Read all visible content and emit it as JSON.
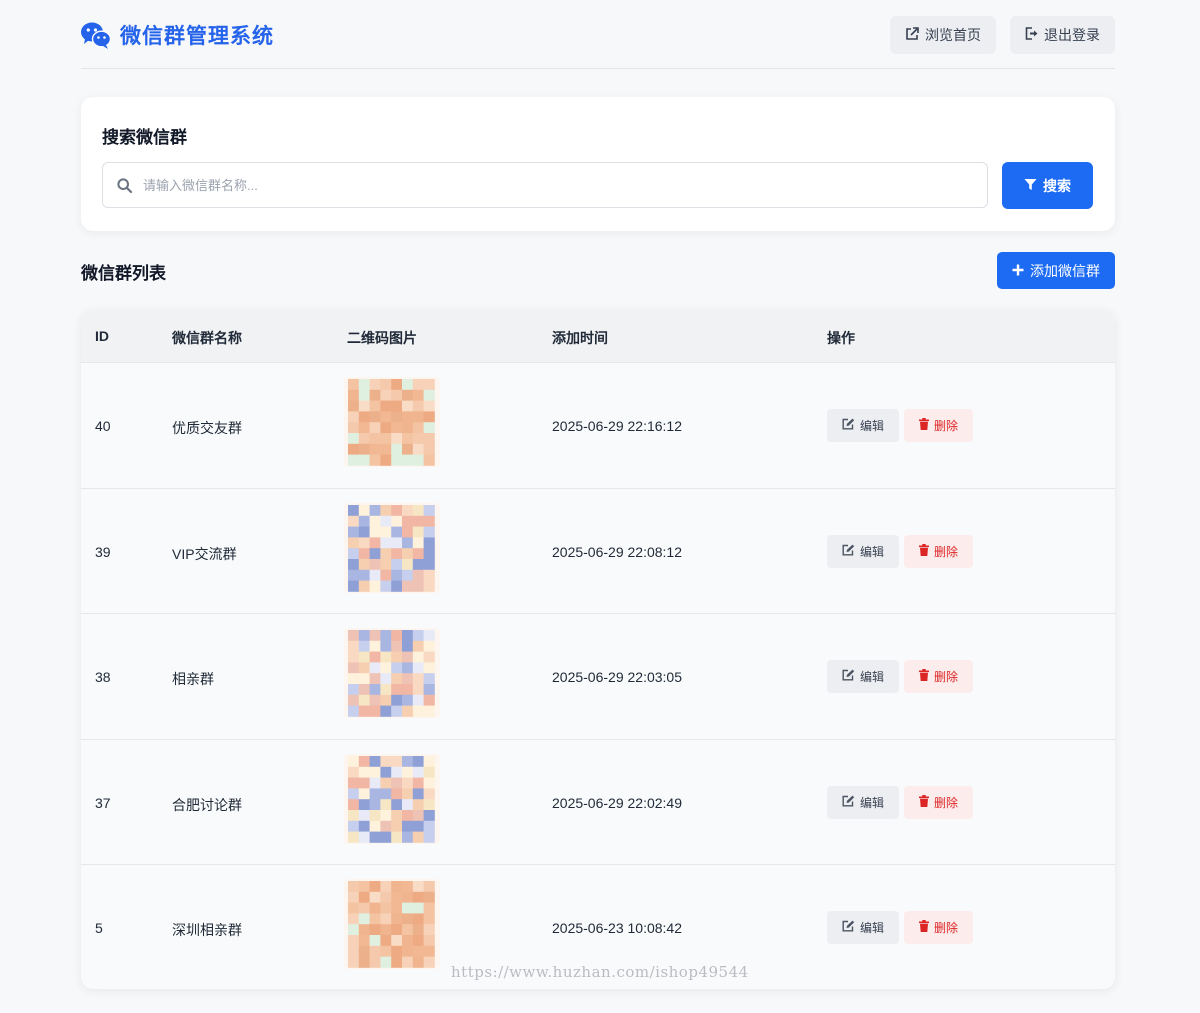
{
  "header": {
    "title": "微信群管理系统",
    "home_label": "浏览首页",
    "logout_label": "退出登录"
  },
  "search": {
    "title": "搜索微信群",
    "placeholder": "请输入微信群名称...",
    "value": "",
    "button_label": "搜索"
  },
  "list": {
    "title": "微信群列表",
    "add_label": "添加微信群",
    "columns": [
      "ID",
      "微信群名称",
      "二维码图片",
      "添加时间",
      "操作"
    ],
    "rows": [
      {
        "id": "40",
        "name": "优质交友群",
        "time": "2025-06-29 22:16:12",
        "edit": "编辑",
        "delete": "删除"
      },
      {
        "id": "39",
        "name": "VIP交流群",
        "time": "2025-06-29 22:08:12",
        "edit": "编辑",
        "delete": "删除"
      },
      {
        "id": "38",
        "name": "相亲群",
        "time": "2025-06-29 22:03:05",
        "edit": "编辑",
        "delete": "删除"
      },
      {
        "id": "37",
        "name": "合肥讨论群",
        "time": "2025-06-29 22:02:49",
        "edit": "编辑",
        "delete": "删除"
      },
      {
        "id": "5",
        "name": "深圳相亲群",
        "time": "2025-06-23 10:08:42",
        "edit": "编辑",
        "delete": "删除"
      }
    ]
  },
  "watermark": "https://www.huzhan.com/ishop49544",
  "colors": {
    "primary": "#1d6bf3",
    "brand_text": "#2563eb",
    "danger": "#dc2626",
    "danger_bg": "#fdecec",
    "page_bg": "#f7f8fa"
  }
}
